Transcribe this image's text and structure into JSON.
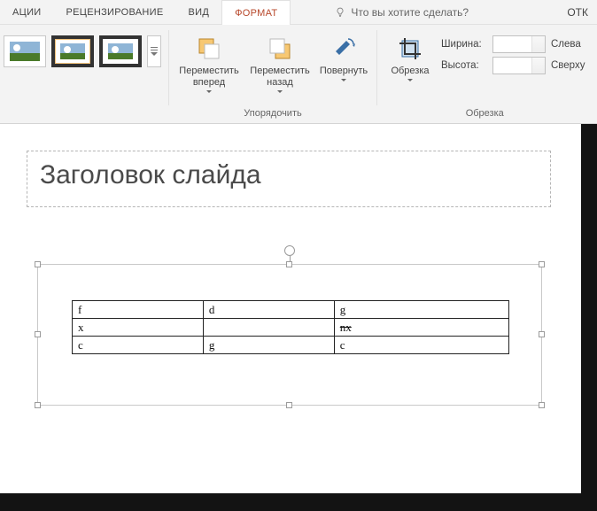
{
  "tabs": {
    "items": [
      "АЦИИ",
      "РЕЦЕНЗИРОВАНИЕ",
      "ВИД",
      "ФОРМАТ"
    ],
    "active_index": 3,
    "tell_me": "Что вы хотите сделать?",
    "right_partial": "ОТК"
  },
  "ribbon": {
    "arrange": {
      "bring_forward": "Переместить\nвперед",
      "send_backward": "Переместить\nназад",
      "rotate": "Повернуть",
      "group_label": "Упорядочить"
    },
    "crop": {
      "crop_btn": "Обрезка",
      "width_label": "Ширина:",
      "height_label": "Высота:",
      "left_label": "Слева",
      "top_label": "Сверху",
      "group_label": "Обрезка"
    }
  },
  "slide": {
    "title": "Заголовок слайда",
    "table": {
      "rows": [
        [
          "f",
          "d",
          "g"
        ],
        [
          "x",
          "",
          "nx"
        ],
        [
          "c",
          "g",
          "c"
        ]
      ],
      "strike_cell": [
        1,
        2
      ]
    }
  }
}
